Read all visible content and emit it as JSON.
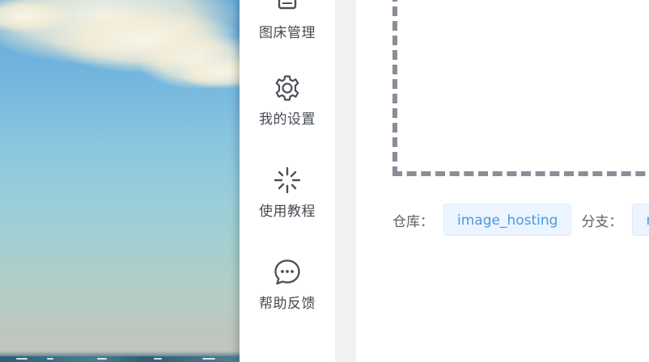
{
  "sidebar": {
    "items": [
      {
        "id": "image-manage",
        "label": "图床管理",
        "icon": "image-manage-icon"
      },
      {
        "id": "settings",
        "label": "我的设置",
        "icon": "gear-icon"
      },
      {
        "id": "tutorial",
        "label": "使用教程",
        "icon": "sparkle-icon"
      },
      {
        "id": "feedback",
        "label": "帮助反馈",
        "icon": "chat-icon"
      }
    ]
  },
  "main": {
    "repo_label": "仓库：",
    "repo_value": "image_hosting",
    "branch_label": "分支：",
    "branch_value": "master"
  },
  "colors": {
    "accent": "#4a98e0",
    "tag_bg": "#ecf5ff",
    "icon": "#4a4f57"
  }
}
